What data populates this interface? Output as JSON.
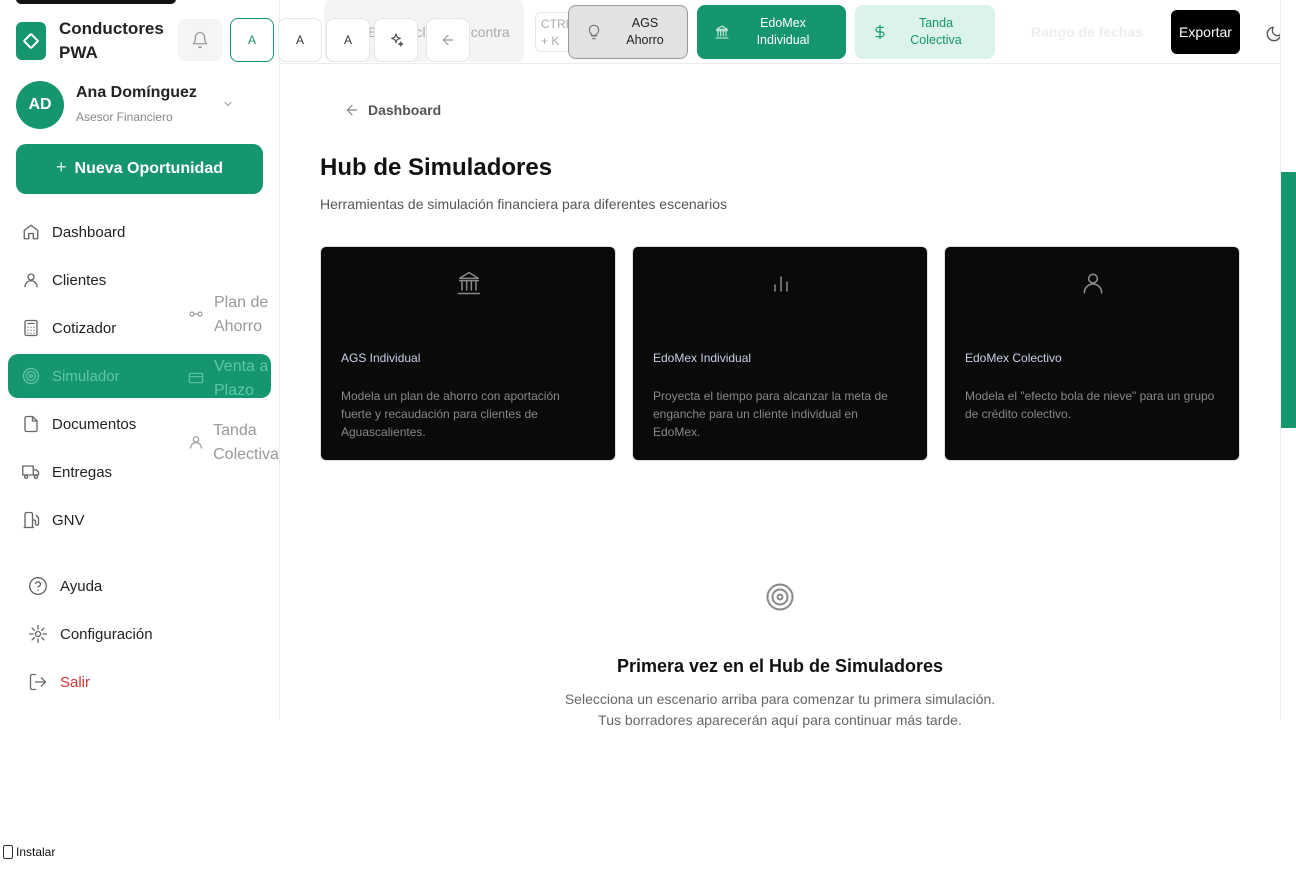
{
  "app": {
    "title": "Conductores PWA"
  },
  "topbar_pills": [
    "A",
    "A",
    "A"
  ],
  "user": {
    "initials": "AD",
    "name": "Ana Domínguez",
    "role": "Asesor Financiero"
  },
  "new_button": {
    "label": "Nueva Oportunidad"
  },
  "nav": [
    {
      "label": "Dashboard",
      "icon": "home-icon"
    },
    {
      "label": "Clientes",
      "icon": "user-icon"
    },
    {
      "label": "Cotizador",
      "icon": "calculator-icon"
    },
    {
      "label": "Simulador",
      "icon": "target-icon",
      "active": true
    },
    {
      "label": "Documentos",
      "icon": "document-icon"
    },
    {
      "label": "Entregas",
      "icon": "truck-icon"
    },
    {
      "label": "GNV",
      "icon": "fuel-icon"
    }
  ],
  "submenu": [
    {
      "label": "Plan de Ahorro",
      "icon": "link-icon"
    },
    {
      "label": "Venta a Plazo",
      "icon": "credit-card-icon"
    },
    {
      "label": "Tanda Colectiva",
      "icon": "user-icon"
    }
  ],
  "footer_nav": [
    {
      "label": "Ayuda",
      "icon": "help-icon"
    },
    {
      "label": "Configuración",
      "icon": "settings-icon"
    },
    {
      "label": "Salir",
      "icon": "logout-icon"
    }
  ],
  "header": {
    "search_placeholder": "Buscar clientes, contratos...",
    "shortcut": "CTRL + K",
    "chips": [
      {
        "label": "AGS Ahorro",
        "icon": "lightbulb-icon"
      },
      {
        "label": "EdoMex Individual",
        "icon": "bank-icon"
      },
      {
        "label": "Tanda Colectiva",
        "icon": "dollar-icon"
      }
    ],
    "date_range": "Rango de fechas",
    "export_label": "Exportar"
  },
  "main": {
    "back_label": "Dashboard",
    "title": "Hub de Simuladores",
    "subtitle": "Herramientas de simulación financiera para diferentes escenarios",
    "cards": [
      {
        "title": "AGS Individual",
        "description": "Modela un plan de ahorro con aportación fuerte y recaudación para clientes de Aguascalientes.",
        "icon": "bank-icon"
      },
      {
        "title": "EdoMex Individual",
        "description": "Proyecta el tiempo para alcanzar la meta de enganche para un cliente individual en EdoMex.",
        "icon": "bar-chart-icon"
      },
      {
        "title": "EdoMex Colectivo",
        "description": "Modela el \"efecto bola de nieve\" para un grupo de crédito colectivo.",
        "icon": "user-icon"
      }
    ],
    "empty": {
      "title": "Primera vez en el Hub de Simuladores",
      "line1": "Selecciona un escenario arriba para comenzar tu primera simulación.",
      "line2": "Tus borradores aparecerán aquí para continuar más tarde."
    }
  },
  "install_label": "Instalar",
  "colors": {
    "brand": "#16966f",
    "brand_light": "#dbf3ea",
    "danger": "#d43535",
    "card_bg": "#0a0a0a"
  }
}
